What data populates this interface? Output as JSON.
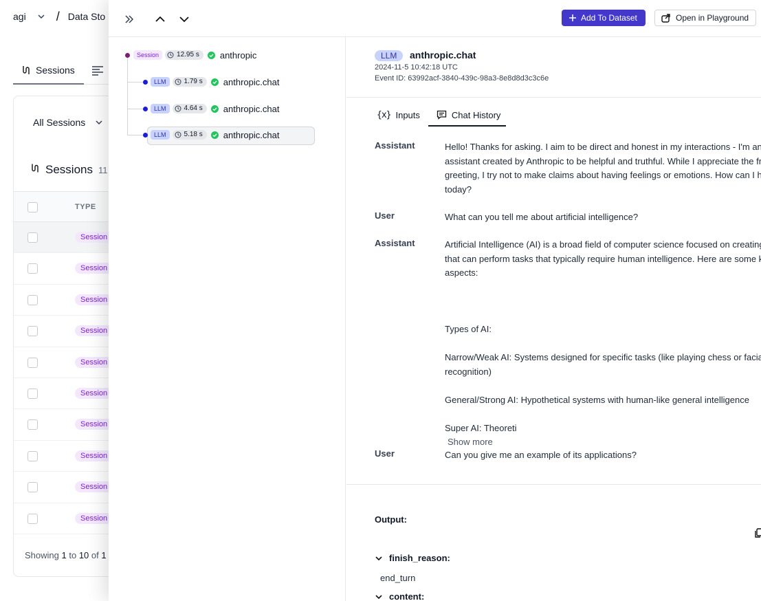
{
  "background": {
    "breadcrumb": {
      "org": "agi",
      "section": "Data Sto"
    },
    "tabs": {
      "sessions_label": "Sessions"
    },
    "filter": {
      "label": "All Sessions"
    },
    "sessions_header": {
      "title": "Sessions",
      "count": "11"
    },
    "table": {
      "type_header": "TYPE",
      "rows": [
        "Session",
        "Session",
        "Session",
        "Session",
        "Session",
        "Session",
        "Session",
        "Session",
        "Session",
        "Session"
      ]
    },
    "footer": {
      "prefix": "Showing",
      "from": "1",
      "to_word": "to",
      "to": "10",
      "of_word": "of",
      "total": "1"
    }
  },
  "toolbar": {
    "add_to_dataset": "Add To Dataset",
    "open_in_playground": "Open in Playground"
  },
  "tree": {
    "root": {
      "badge": "Session",
      "duration": "12.95 s",
      "name": "anthropic"
    },
    "children": [
      {
        "badge": "LLM",
        "duration": "1.79 s",
        "name": "anthropic.chat"
      },
      {
        "badge": "LLM",
        "duration": "4.64 s",
        "name": "anthropic.chat"
      },
      {
        "badge": "LLM",
        "duration": "5.18 s",
        "name": "anthropic.chat"
      }
    ]
  },
  "event": {
    "badge": "LLM",
    "title": "anthropic.chat",
    "timestamp": "2024-11-5 10:42:18 UTC",
    "event_id": "Event ID: 63992acf-3840-439c-98a3-8e8d8d3c3c6e"
  },
  "tabs": {
    "inputs": "Inputs",
    "chat_history": "Chat History"
  },
  "chat": [
    {
      "role": "Assistant",
      "text": "Hello! Thanks for asking. I aim to be direct and honest in my interactions - I'm an AI assistant created by Anthropic to be helpful and truthful. While I appreciate the friendly greeting, I try not to make claims about having feelings or emotions. How can I help you today?"
    },
    {
      "role": "User",
      "text": "What can you tell me about artificial intelligence?"
    },
    {
      "role": "Assistant",
      "paragraphs": [
        "Artificial Intelligence (AI) is a broad field of computer science focused on creating systems that can perform tasks that typically require human intelligence. Here are some key aspects:",
        "",
        "Types of AI:",
        "Narrow/Weak AI: Systems designed for specific tasks (like playing chess or facial recognition)",
        "General/Strong AI: Hypothetical systems with human-like general intelligence",
        "Super AI: Theoreti"
      ],
      "show_more": "Show more"
    },
    {
      "role": "User",
      "text": "Can you give me an example of its applications?"
    }
  ],
  "output": {
    "label": "Output:",
    "finish_reason_key": "finish_reason:",
    "finish_reason_value": "end_turn",
    "content_key": "content:"
  },
  "colors": {
    "primary": "#4338ca",
    "session_badge_bg": "#f3e8ff",
    "session_badge_fg": "#7e22ce",
    "llm_badge_bg": "#c7d2fe",
    "llm_badge_fg": "#3730a3",
    "success": "#22c55e"
  },
  "icons": [
    "chevron-down-icon",
    "sessions-icon",
    "list-icon",
    "double-chevron-right-icon",
    "chevron-up-icon",
    "plus-icon",
    "external-open-icon",
    "clock-icon",
    "check-circle-icon",
    "variable-icon",
    "chat-icon",
    "copy-icon"
  ]
}
